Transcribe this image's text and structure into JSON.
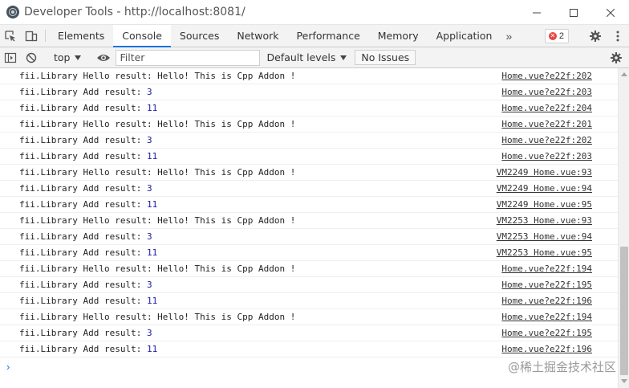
{
  "window": {
    "title": "Developer Tools - http://localhost:8081/"
  },
  "tabs": [
    {
      "label": "Elements"
    },
    {
      "label": "Console"
    },
    {
      "label": "Sources"
    },
    {
      "label": "Network"
    },
    {
      "label": "Performance"
    },
    {
      "label": "Memory"
    },
    {
      "label": "Application"
    }
  ],
  "more_tabs": "»",
  "error_count": "2",
  "console_toolbar": {
    "context": "top",
    "filter_placeholder": "Filter",
    "levels": "Default levels",
    "issues": "No Issues"
  },
  "logs": [
    {
      "prefix": "fii.Library Hello result: Hello! This is Cpp Addon !",
      "num": "",
      "src": "Home.vue?e22f:202"
    },
    {
      "prefix": "fii.Library Add result: ",
      "num": "3",
      "src": "Home.vue?e22f:203"
    },
    {
      "prefix": "fii.Library Add result: ",
      "num": "11",
      "src": "Home.vue?e22f:204"
    },
    {
      "prefix": "fii.Library Hello result: Hello! This is Cpp Addon !",
      "num": "",
      "src": "Home.vue?e22f:201"
    },
    {
      "prefix": "fii.Library Add result: ",
      "num": "3",
      "src": "Home.vue?e22f:202"
    },
    {
      "prefix": "fii.Library Add result: ",
      "num": "11",
      "src": "Home.vue?e22f:203"
    },
    {
      "prefix": "fii.Library Hello result: Hello! This is Cpp Addon !",
      "num": "",
      "src": "VM2249 Home.vue:93"
    },
    {
      "prefix": "fii.Library Add result: ",
      "num": "3",
      "src": "VM2249 Home.vue:94"
    },
    {
      "prefix": "fii.Library Add result: ",
      "num": "11",
      "src": "VM2249 Home.vue:95"
    },
    {
      "prefix": "fii.Library Hello result: Hello! This is Cpp Addon !",
      "num": "",
      "src": "VM2253 Home.vue:93"
    },
    {
      "prefix": "fii.Library Add result: ",
      "num": "3",
      "src": "VM2253 Home.vue:94"
    },
    {
      "prefix": "fii.Library Add result: ",
      "num": "11",
      "src": "VM2253 Home.vue:95"
    },
    {
      "prefix": "fii.Library Hello result: Hello! This is Cpp Addon !",
      "num": "",
      "src": "Home.vue?e22f:194"
    },
    {
      "prefix": "fii.Library Add result: ",
      "num": "3",
      "src": "Home.vue?e22f:195"
    },
    {
      "prefix": "fii.Library Add result: ",
      "num": "11",
      "src": "Home.vue?e22f:196"
    },
    {
      "prefix": "fii.Library Hello result: Hello! This is Cpp Addon !",
      "num": "",
      "src": "Home.vue?e22f:194"
    },
    {
      "prefix": "fii.Library Add result: ",
      "num": "3",
      "src": "Home.vue?e22f:195"
    },
    {
      "prefix": "fii.Library Add result: ",
      "num": "11",
      "src": "Home.vue?e22f:196"
    }
  ],
  "prompt": "›",
  "watermark": "@稀土掘金技术社区",
  "colors": {
    "accent": "#1a73e8",
    "error": "#e8453c",
    "number": "#1a1aa6"
  },
  "icons": {
    "inspect": "inspect-element-icon",
    "device": "device-toolbar-icon",
    "sidebar": "console-sidebar-icon",
    "clear": "clear-console-icon",
    "eye": "live-expression-icon",
    "gear": "gear-icon"
  }
}
